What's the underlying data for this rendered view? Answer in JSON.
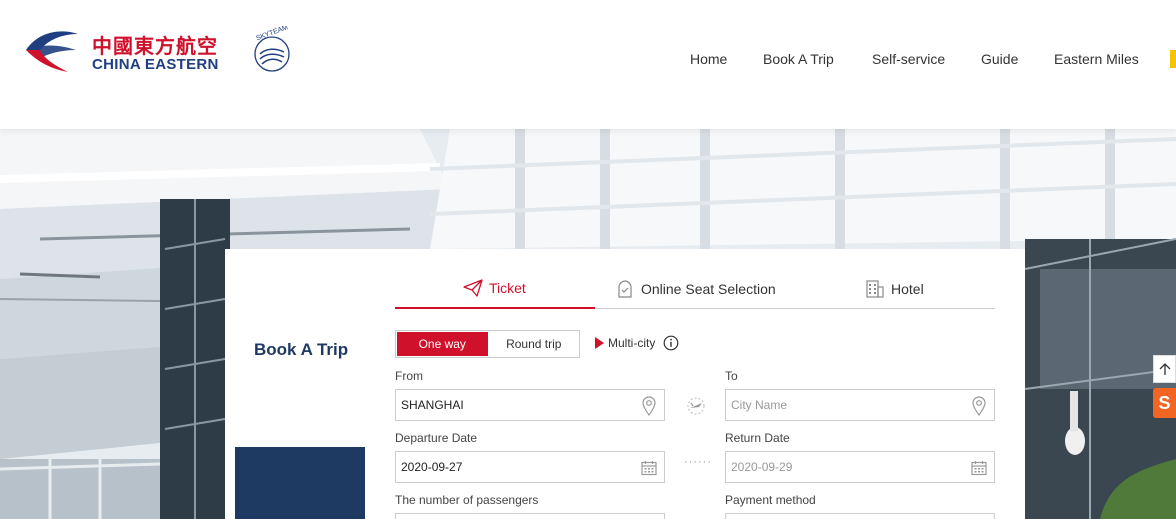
{
  "brand": {
    "name_cn": "中國東方航空",
    "name_en": "CHINA EASTERN",
    "alliance": "SKYTEAM",
    "brand_red": "#d0112b",
    "brand_navy": "#1f3f80"
  },
  "nav": {
    "items": [
      {
        "label": "Home"
      },
      {
        "label": "Book A Trip"
      },
      {
        "label": "Self-service"
      },
      {
        "label": "Guide"
      },
      {
        "label": "Eastern Miles"
      }
    ]
  },
  "booking": {
    "title": "Book A Trip",
    "tabs": [
      {
        "label": "Ticket",
        "icon": "paper-plane-icon",
        "active": true
      },
      {
        "label": "Online Seat Selection",
        "icon": "seat-icon",
        "active": false
      },
      {
        "label": "Hotel",
        "icon": "building-icon",
        "active": false
      }
    ],
    "trip_types": [
      {
        "label": "One way",
        "active": true
      },
      {
        "label": "Round trip",
        "active": false
      }
    ],
    "multi_city_label": "Multi-city",
    "from": {
      "label": "From",
      "value": "SHANGHAI",
      "placeholder": ""
    },
    "to": {
      "label": "To",
      "value": "",
      "placeholder": "City Name"
    },
    "departure": {
      "label": "Departure Date",
      "value": "2020-09-27"
    },
    "return": {
      "label": "Return Date",
      "value": "2020-09-29"
    },
    "passengers_label": "The number of passengers",
    "payment_label": "Payment method"
  },
  "side": {
    "badge": "S"
  }
}
